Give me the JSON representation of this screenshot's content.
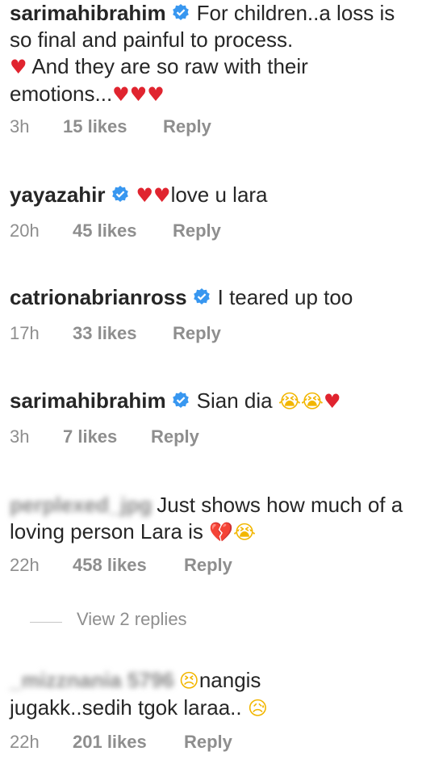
{
  "comments": [
    {
      "user": "sarimahibrahim",
      "text": "For children..a loss is so final and painful to process.",
      "text2": "And they are so raw with their emotions...",
      "time": "3h",
      "likes": "15 likes",
      "reply": "Reply"
    },
    {
      "user": "yayazahir",
      "text": "love u lara",
      "time": "20h",
      "likes": "45 likes",
      "reply": "Reply"
    },
    {
      "user": "catrionabrianross",
      "text": "I teared up too",
      "time": "17h",
      "likes": "33 likes",
      "reply": "Reply"
    },
    {
      "user": "sarimahibrahim",
      "text": "Sian dia",
      "time": "3h",
      "likes": "7 likes",
      "reply": "Reply"
    },
    {
      "user": "perplexed_jpg",
      "text": "Just shows how much of a loving person Lara is",
      "time": "22h",
      "likes": "458 likes",
      "reply": "Reply"
    },
    {
      "user": "_mizznania 5796",
      "text": "nangis",
      "text2": "jugakk..sedih tgok laraa..",
      "time": "22h",
      "likes": "201 likes",
      "reply": "Reply"
    }
  ],
  "view_replies": "View 2 replies",
  "icons": {
    "verified": "verified-badge-icon",
    "heart": "red-heart-icon",
    "crying": "crying-face-icon",
    "broken_heart": "broken-heart-icon",
    "persevering": "persevering-face-icon",
    "sad": "sad-face-icon"
  },
  "colors": {
    "verified_blue": "#3897f0",
    "heart_red": "#e0242f",
    "meta_gray": "#8e8e8e"
  }
}
